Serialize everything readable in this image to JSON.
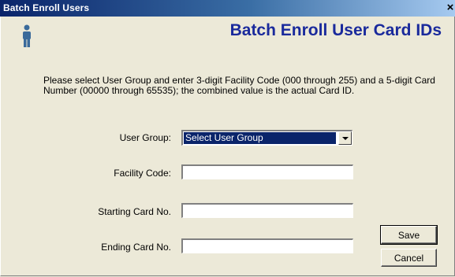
{
  "window": {
    "title": "Batch Enroll Users",
    "close_label": "×"
  },
  "header": {
    "title": "Batch Enroll User Card IDs",
    "icon": "person-icon",
    "accent_color": "#1a2a9c"
  },
  "instructions": "Please select User Group and enter 3-digit Facility Code (000 through 255) and a 5-digit Card Number (00000 through 65535); the combined value is the actual Card ID.",
  "form": {
    "user_group": {
      "label": "User Group:",
      "selected": "Select User Group"
    },
    "facility_code": {
      "label": "Facility Code:",
      "value": ""
    },
    "starting_card": {
      "label": "Starting Card No.",
      "value": ""
    },
    "ending_card": {
      "label": "Ending Card No.",
      "value": ""
    }
  },
  "buttons": {
    "save": "Save",
    "cancel": "Cancel"
  }
}
